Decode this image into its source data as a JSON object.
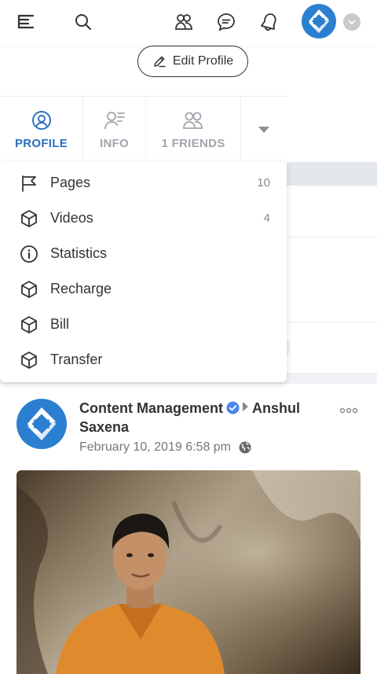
{
  "header": {
    "icons": [
      "menu-icon",
      "search-icon",
      "friends-icon",
      "chat-icon",
      "notification-bell-icon",
      "user-avatar",
      "chevron-down-icon"
    ]
  },
  "profile": {
    "edit_button_label": "Edit Profile",
    "tabs": [
      {
        "label": "PROFILE",
        "icon": "user-circle-icon",
        "active": true
      },
      {
        "label": "INFO",
        "icon": "user-info-icon",
        "active": false
      },
      {
        "label": "1 FRIENDS",
        "icon": "friends-icon",
        "active": false
      }
    ]
  },
  "dropdown": {
    "items": [
      {
        "label": "Pages",
        "icon": "flag-icon",
        "count": "10"
      },
      {
        "label": "Videos",
        "icon": "cube-icon",
        "count": "4"
      },
      {
        "label": "Statistics",
        "icon": "info-circle-icon",
        "count": ""
      },
      {
        "label": "Recharge",
        "icon": "cube-icon",
        "count": ""
      },
      {
        "label": "Bill",
        "icon": "cube-icon",
        "count": ""
      },
      {
        "label": "Transfer",
        "icon": "cube-icon",
        "count": ""
      }
    ]
  },
  "post": {
    "author": "Content Management",
    "target": "Anshul Saxena",
    "date": "February 10, 2019 6:58 pm"
  },
  "colors": {
    "accent": "#2b6fbf",
    "brand_blue": "#2b7fd1"
  }
}
